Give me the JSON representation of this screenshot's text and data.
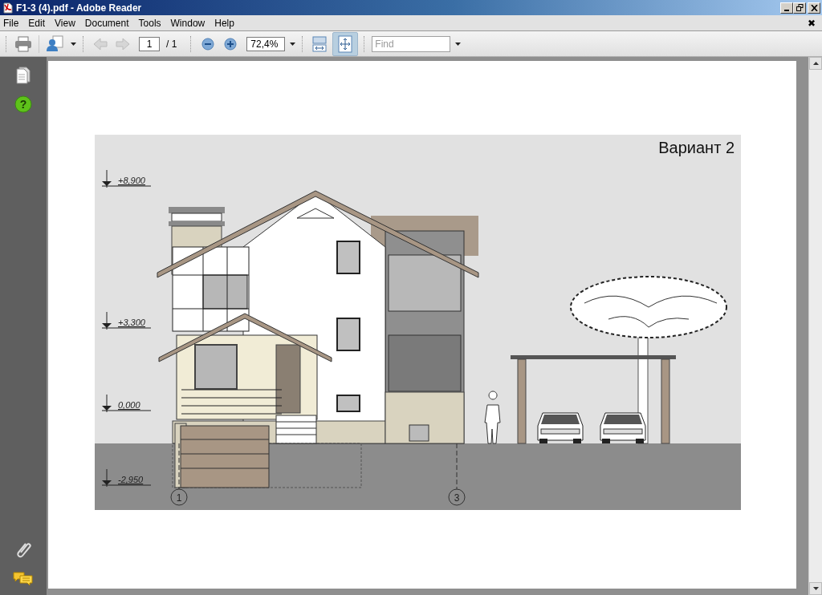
{
  "window": {
    "title": "F1-3 (4).pdf - Adobe Reader"
  },
  "menu": [
    "File",
    "Edit",
    "View",
    "Document",
    "Tools",
    "Window",
    "Help"
  ],
  "close_document": "✖",
  "toolbar": {
    "previous_disabled": true,
    "next_disabled": true,
    "page_number": "1",
    "page_count": "/ 1",
    "zoom": "72,4%",
    "fit_width_selected": false,
    "fit_page_selected": true,
    "find_placeholder": "Find"
  },
  "sidebar": {
    "help_glyph": "?"
  },
  "drawing": {
    "title": "Вариант 2",
    "levels": [
      "+8,900",
      "+3,300",
      "0,000",
      "-2,950"
    ],
    "axes": [
      "1",
      "3"
    ]
  }
}
